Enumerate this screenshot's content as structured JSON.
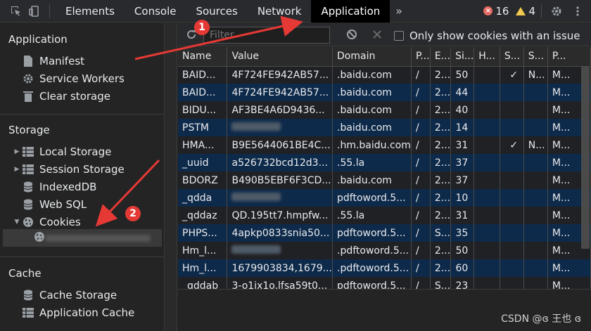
{
  "topbar": {
    "tabs": [
      "Elements",
      "Console",
      "Sources",
      "Network",
      "Application"
    ],
    "more": "»",
    "errors": "16",
    "warnings": "4"
  },
  "sidebar": {
    "application_title": "Application",
    "application_items": [
      "Manifest",
      "Service Workers",
      "Clear storage"
    ],
    "storage_title": "Storage",
    "storage_items": [
      "Local Storage",
      "Session Storage",
      "IndexedDB",
      "Web SQL",
      "Cookies"
    ],
    "cache_title": "Cache",
    "cache_items": [
      "Cache Storage",
      "Application Cache"
    ]
  },
  "toolbar": {
    "filter_placeholder": "Filter",
    "only_issue_label": "Only show cookies with an issue"
  },
  "table": {
    "headers": [
      "Name",
      "Value",
      "Domain",
      "P...",
      "E...",
      "Si...",
      "H...",
      "S...",
      "S...",
      "P..."
    ],
    "rows": [
      [
        "BAID...",
        "4F724FE942AB57...",
        ".baidu.com",
        "/",
        "2...",
        "50",
        "",
        "✓",
        "N...",
        "M..."
      ],
      [
        "BAID...",
        "4F724FE942AB57...",
        ".baidu.com",
        "/",
        "2...",
        "44",
        "",
        "",
        "",
        "M..."
      ],
      [
        "BIDU...",
        "AF3BE4A6D9436...",
        ".baidu.com",
        "/",
        "2...",
        "40",
        "",
        "",
        "",
        "M..."
      ],
      [
        "PSTM",
        "",
        ".baidu.com",
        "/",
        "2...",
        "14",
        "",
        "",
        "",
        "M..."
      ],
      [
        "HMA...",
        "B9E5644061BE4C...",
        ".hm.baidu.com",
        "/",
        "2...",
        "31",
        "",
        "✓",
        "N...",
        "M..."
      ],
      [
        "_uuid",
        "a526732bcd12d3...",
        ".55.la",
        "/",
        "2...",
        "37",
        "",
        "",
        "",
        "M..."
      ],
      [
        "BDORZ",
        "B490B5EBF6F3CD...",
        ".baidu.com",
        "/",
        "2...",
        "37",
        "",
        "",
        "",
        "M..."
      ],
      [
        "_qdda",
        "",
        "pdftoword.5...",
        "/",
        "2...",
        "10",
        "",
        "",
        "",
        "M..."
      ],
      [
        "_qddaz",
        "QD.195tt7.hmpfw...",
        ".55.la",
        "/",
        "2...",
        "31",
        "",
        "",
        "",
        "M..."
      ],
      [
        "PHPS...",
        "4apkp0833snia50...",
        "pdftoword.5...",
        "/",
        "S...",
        "35",
        "",
        "",
        "",
        "M..."
      ],
      [
        "Hm_l...",
        "",
        ".pdftoword.5...",
        "/",
        "2...",
        "50",
        "",
        "",
        "",
        "M..."
      ],
      [
        "Hm_l...",
        "1679903834,1679...",
        ".pdftoword.5...",
        "/",
        "2...",
        "60",
        "",
        "",
        "",
        "M..."
      ],
      [
        "_qddab",
        "3-o1ix1o.lfsa59t0...",
        "pdftoword.5...",
        "/",
        "S...",
        "23",
        "",
        "",
        "",
        "M..."
      ]
    ]
  },
  "annotations": [
    "1",
    "2"
  ],
  "watermark": "CSDN @ɞ 王也 ɞ"
}
